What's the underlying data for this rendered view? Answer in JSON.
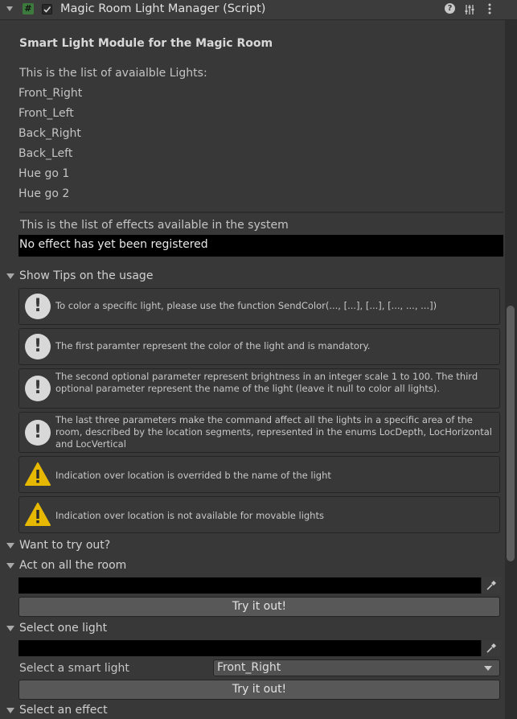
{
  "header": {
    "component_title": "Magic Room Light Manager (Script)"
  },
  "module_title": "Smart Light Module for the Magic Room",
  "lights_heading": "This is the list of avaialble Lights:",
  "lights": [
    "Front_Right",
    "Front_Left",
    "Back_Right",
    "Back_Left",
    "Hue go 1",
    "Hue go 2"
  ],
  "effects_heading": "This is the list of effects available in the system",
  "effects_status": "No effect has yet been registered",
  "tips": {
    "foldout_label": "Show Tips on the usage",
    "items": [
      {
        "type": "info",
        "text": "To color a specific light, please use the function SendColor(..., [...], [...], [..., ..., ...])"
      },
      {
        "type": "info",
        "text": "The first paramter represent the color of the light and is mandatory."
      },
      {
        "type": "info",
        "text": "The second optional parameter represent brightness in an integer scale 1 to 100. The third optional parameter represent the name of the light (leave it null to color all lights)."
      },
      {
        "type": "info",
        "text": "The last three parameters make the command affect all the lights in a specific area of the room, described by the location segments, represented in the enums LocDepth, LocHorizontal and LocVertical"
      },
      {
        "type": "warning",
        "text": "Indication over location is overrided b the name of the light"
      },
      {
        "type": "warning",
        "text": "Indication over location is not available for movable lights"
      }
    ]
  },
  "try_out": {
    "foldout_label": "Want to try out?",
    "all_room": {
      "foldout_label": "Act on all the room",
      "button_label": "Try it out!"
    },
    "one_light": {
      "foldout_label": "Select one light",
      "field_label": "Select a smart light",
      "selected_light": "Front_Right",
      "button_label": "Try it out!"
    },
    "effect": {
      "foldout_label": "Select an effect"
    }
  },
  "colors": {
    "background": "#383838",
    "field_black": "#000000",
    "warning_yellow": "#e6b800",
    "info_white": "#d8d8d8"
  }
}
